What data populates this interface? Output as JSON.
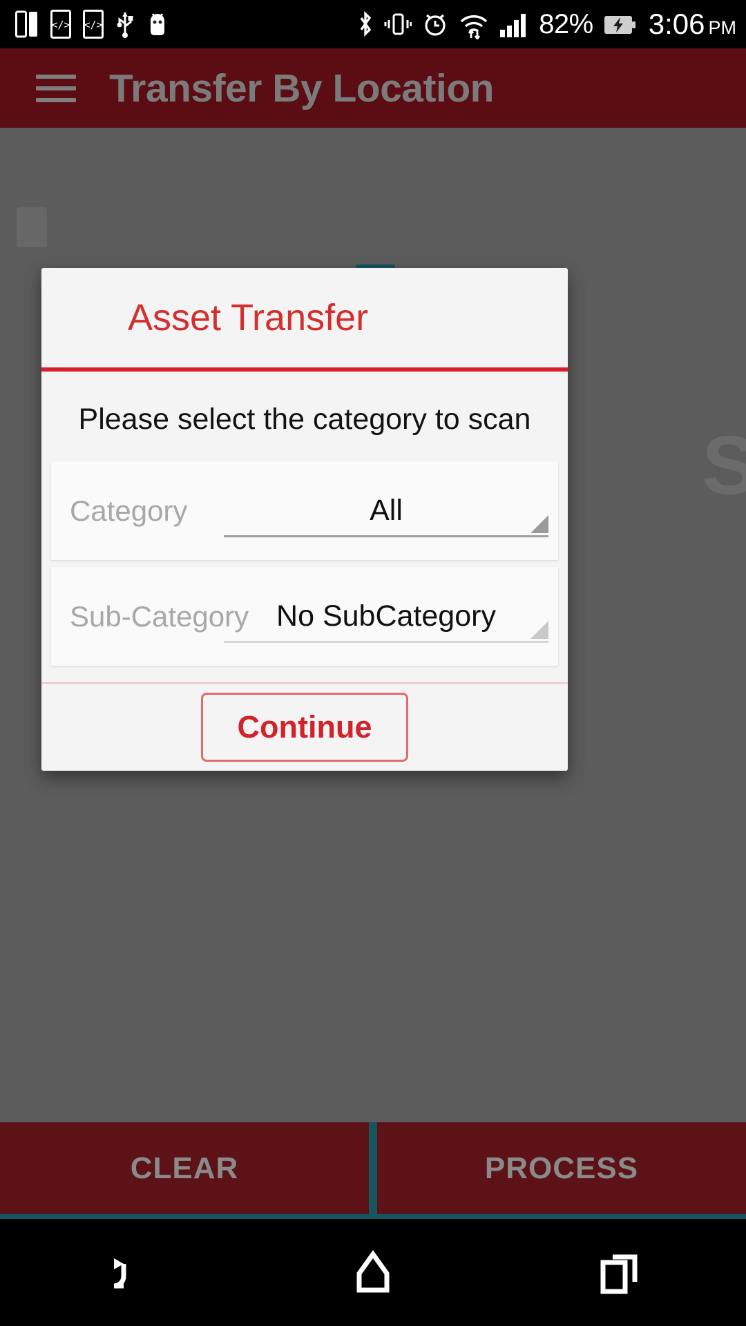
{
  "statusbar": {
    "left_icons": [
      {
        "name": "multi-window-icon"
      },
      {
        "name": "developer-code-icon"
      },
      {
        "name": "developer-code-icon-2"
      },
      {
        "name": "usb-icon"
      },
      {
        "name": "android-debug-icon"
      }
    ],
    "right_icons": [
      {
        "name": "bluetooth-icon"
      },
      {
        "name": "vibrate-icon"
      },
      {
        "name": "alarm-icon"
      },
      {
        "name": "wifi-data-transfer-icon"
      },
      {
        "name": "signal-bars-icon"
      }
    ],
    "battery_percent": "82%",
    "battery_icon": "battery-charging-icon",
    "time": "3:06",
    "ampm": "PM"
  },
  "appbar": {
    "menu_icon": "hamburger-menu-icon",
    "title": "Transfer By Location"
  },
  "dialog": {
    "title": "Asset Transfer",
    "instruction": "Please select the category to scan",
    "fields": [
      {
        "label": "Category",
        "value": "All",
        "caret_icon": "spinner-caret-icon"
      },
      {
        "label": "Sub-Category",
        "value": "No SubCategory",
        "caret_icon": "spinner-caret-icon"
      }
    ],
    "continue_label": "Continue"
  },
  "actionbar": {
    "clear_label": "CLEAR",
    "process_label": "PROCESS"
  },
  "navbar": {
    "back_icon": "back-arrow-icon",
    "home_icon": "home-icon",
    "recents_icon": "recent-apps-icon"
  },
  "colors": {
    "appbar_maroon": "#5C0D13",
    "accent_red": "#D32F2F",
    "divider_red": "#D9202A",
    "dialog_bg": "#F5F4F4",
    "scrim_gray": "#5C5C5C",
    "teal_border": "#14555F",
    "button_maroon": "#5C1217"
  }
}
